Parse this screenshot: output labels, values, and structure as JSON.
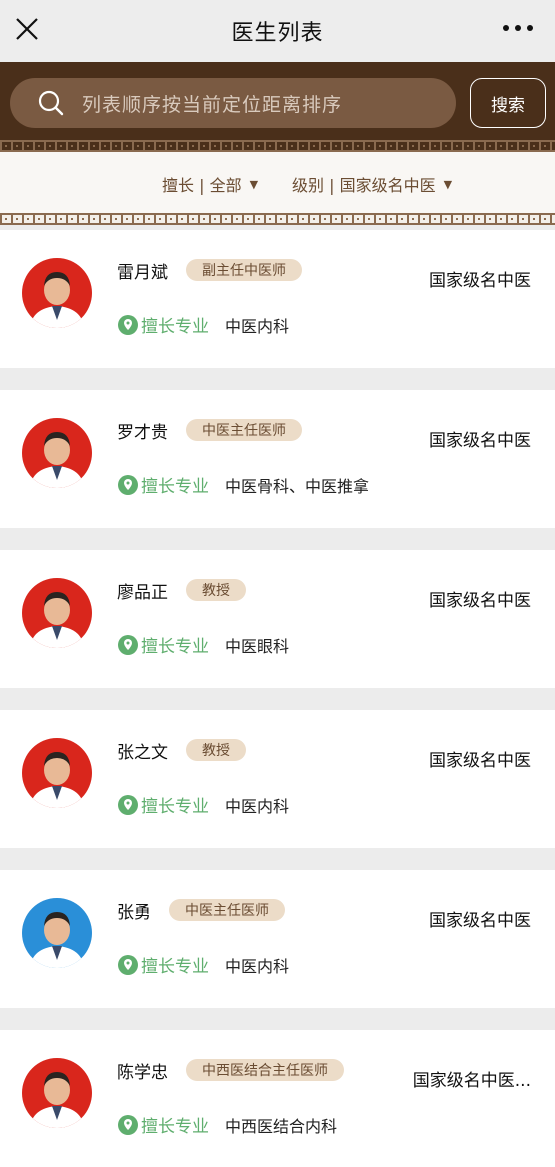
{
  "header": {
    "title": "医生列表",
    "close_icon": "close-icon",
    "more_icon": "more-icon"
  },
  "search": {
    "placeholder": "列表顺序按当前定位距离排序",
    "button_label": "搜索"
  },
  "filters": {
    "specialty": "擅长 | 全部",
    "level": "级别 | 国家级名中医"
  },
  "colors": {
    "brand_brown": "#4a2f1a",
    "search_bg": "#7a5a42",
    "tag_bg": "#ecdcc8",
    "tag_text": "#6b4d33",
    "specialty_green": "#5fae6e"
  },
  "specialty_label": "擅长专业",
  "doctors": [
    {
      "name": "雷月斌",
      "title": "副主任中医师",
      "level": "国家级名中医",
      "specialty": "中医内科",
      "avatar_bg": "#d9261c"
    },
    {
      "name": "罗才贵",
      "title": "中医主任医师",
      "level": "国家级名中医",
      "specialty": "中医骨科、中医推拿",
      "avatar_bg": "#d9261c"
    },
    {
      "name": "廖品正",
      "title": "教授",
      "level": "国家级名中医",
      "specialty": "中医眼科",
      "avatar_bg": "#d9261c"
    },
    {
      "name": "张之文",
      "title": "教授",
      "level": "国家级名中医",
      "specialty": "中医内科",
      "avatar_bg": "#d9261c"
    },
    {
      "name": "张勇",
      "title": "中医主任医师",
      "level": "国家级名中医",
      "specialty": "中医内科",
      "avatar_bg": "#2a8fd8"
    },
    {
      "name": "陈学忠",
      "title": "中西医结合主任医师",
      "level": "国家级名中医...",
      "specialty": "中西医结合内科",
      "avatar_bg": "#d9261c"
    }
  ]
}
